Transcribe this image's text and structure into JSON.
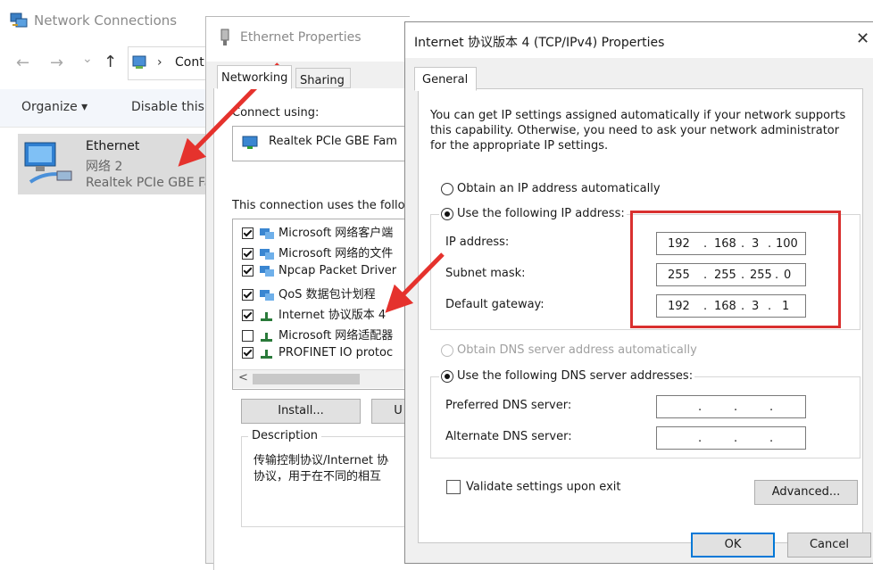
{
  "network_connections": {
    "title": "Network Connections",
    "nav": {
      "back": "←",
      "forward": "→",
      "recent": "⌄",
      "up": "↑"
    },
    "address_text": "Cont",
    "toolbar": {
      "organize": "Organize ▾",
      "disable": "Disable this"
    },
    "item": {
      "name": "Ethernet",
      "network": "网络 2",
      "adapter": "Realtek PCIe GBE Fa"
    }
  },
  "ethernet_properties": {
    "title": "Ethernet Properties",
    "tabs": [
      "Networking",
      "Sharing"
    ],
    "connect_using_label": "Connect using:",
    "adapter": "Realtek PCIe GBE Fam",
    "uses_label": "This connection uses the follo",
    "items": [
      {
        "label": "Microsoft 网络客户端",
        "checked": true
      },
      {
        "label": "Microsoft 网络的文件",
        "checked": true
      },
      {
        "label": "Npcap Packet Driver",
        "checked": true
      },
      {
        "label": "QoS 数据包计划程",
        "checked": true
      },
      {
        "label": "Internet 协议版本 4",
        "checked": true
      },
      {
        "label": "Microsoft 网络适配器",
        "checked": false
      },
      {
        "label": "PROFINET IO protoc",
        "checked": true
      }
    ],
    "scroll_left": "<",
    "install_button": "Install...",
    "second_button": "U",
    "description_label": "Description",
    "description_line1": "传输控制协议/Internet 协",
    "description_line2": "协议，用于在不同的相互"
  },
  "ipv4": {
    "title": "Internet 协议版本 4 (TCP/IPv4) Properties",
    "close": "✕",
    "tab": "General",
    "info_line1": "You can get IP settings assigned automatically if your network supports",
    "info_line2": "this capability. Otherwise, you need to ask your network administrator",
    "info_line3": "for the appropriate IP settings.",
    "auto_ip": "Obtain an IP address automatically",
    "manual_ip": "Use the following IP address:",
    "fields": [
      {
        "label": "IP address:",
        "octets": [
          "192",
          "168",
          "3",
          "100"
        ]
      },
      {
        "label": "Subnet mask:",
        "octets": [
          "255",
          "255",
          "255",
          "0"
        ]
      },
      {
        "label": "Default gateway:",
        "octets": [
          "192",
          "168",
          "3",
          "1"
        ]
      }
    ],
    "auto_dns": "Obtain DNS server address automatically",
    "manual_dns": "Use the following DNS server addresses:",
    "dns_fields": [
      {
        "label": "Preferred DNS server:"
      },
      {
        "label": "Alternate DNS server:"
      }
    ],
    "dot": ".",
    "validate": "Validate settings upon exit",
    "advanced_button": "Advanced...",
    "ok_button": "OK",
    "cancel_button": "Cancel"
  }
}
